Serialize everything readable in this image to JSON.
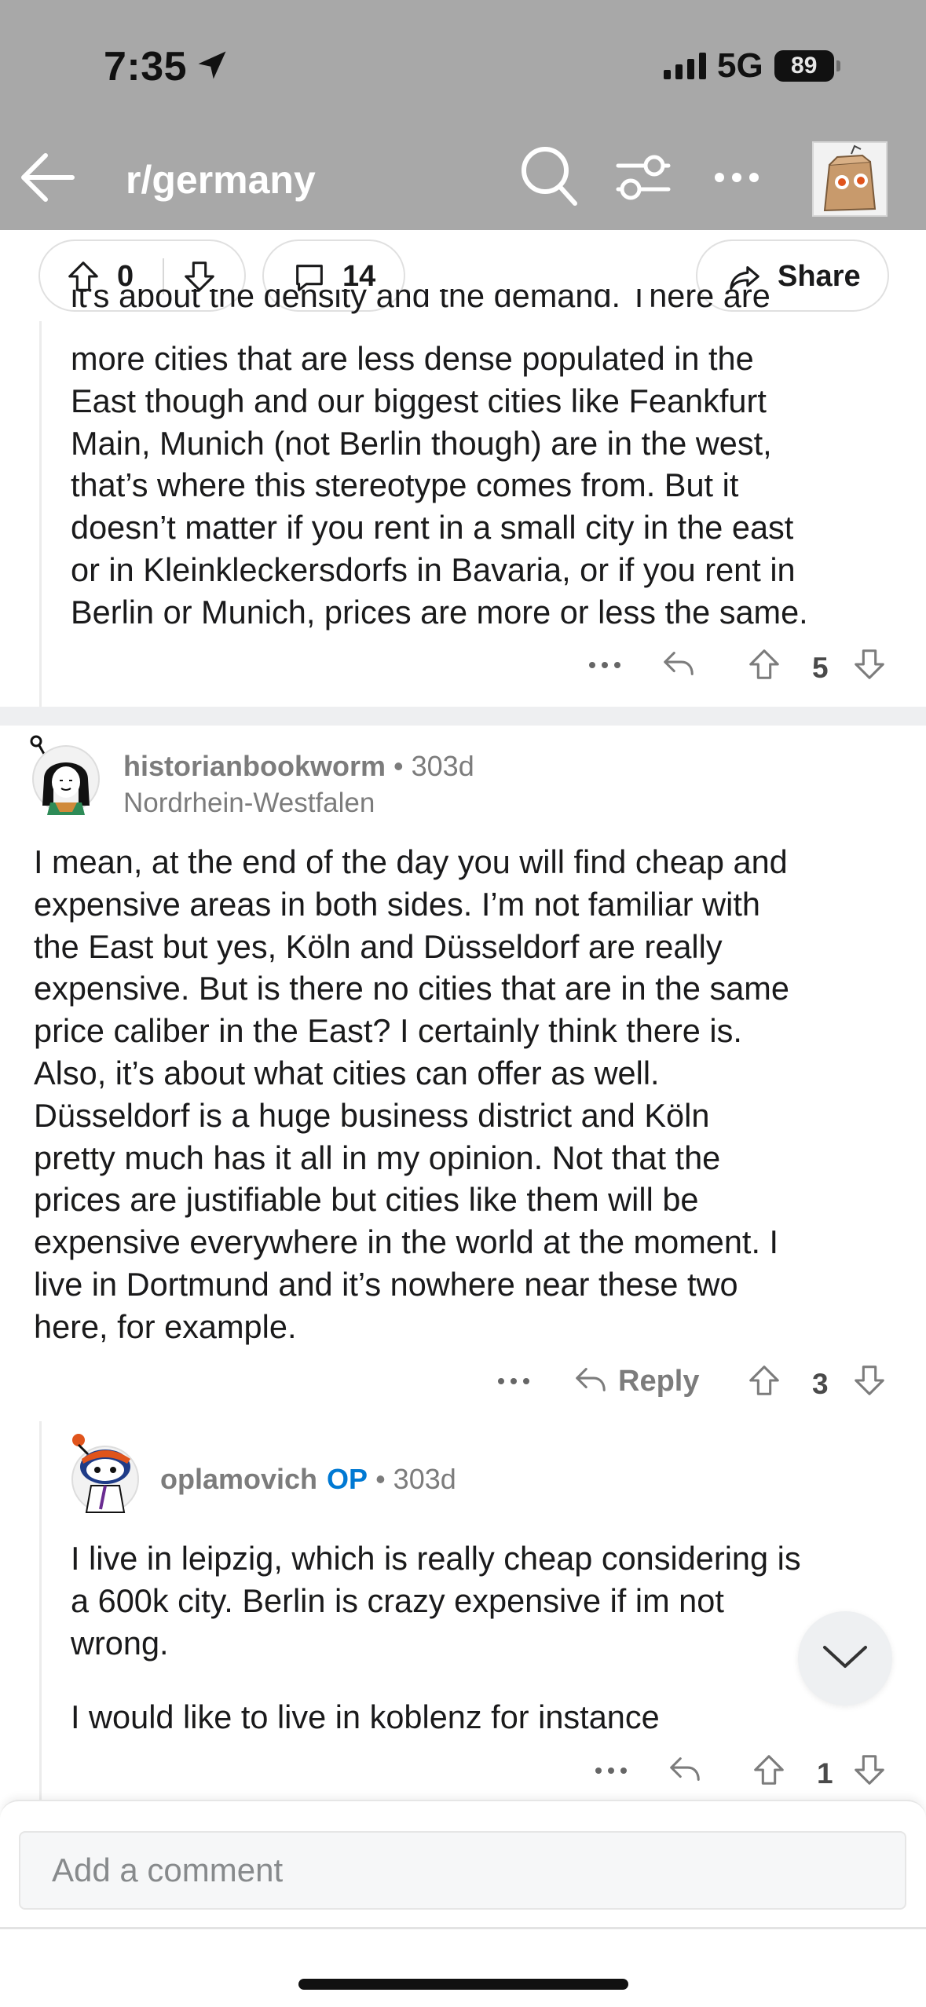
{
  "status_bar": {
    "time": "7:35",
    "network": "5G",
    "battery": "89"
  },
  "nav": {
    "title": "r/germany",
    "back_icon": "arrow-left-icon",
    "search_icon": "search-icon",
    "filter_icon": "sliders-icon",
    "more_icon": "more-horizontal-icon"
  },
  "post_actions": {
    "upvotes": "0",
    "comments": "14",
    "share_label": "Share"
  },
  "comments": [
    {
      "partial_first_line": "it's about the density and the demand. There are",
      "body_lines": [
        "more cities that are less dense populated in the",
        "East though and our biggest cities like Feankfurt",
        "Main, Munich (not Berlin though) are in the west,",
        "that’s where this stereotype comes from. But it",
        "doesn’t matter if you rent in a small city in the east",
        "or in Kleinkleckersdorfs in Bavaria, or if you rent in",
        "Berlin or Munich, prices are more or less the same."
      ],
      "score": "5"
    },
    {
      "username": "historianbookworm",
      "age": "303d",
      "flair": "Nordrhein-Westfalen",
      "body_lines": [
        "I mean, at the end of the day you will find cheap and",
        "expensive areas in both sides. I’m not familiar with",
        "the East but yes, Köln and Düsseldorf are really",
        "expensive. But is there no cities that are in the same",
        "price caliber in the East? I certainly think there is.",
        "Also, it’s about what cities can offer as well.",
        "Düsseldorf is a huge business district and Köln",
        "pretty much has it all in my opinion. Not that the",
        "prices are justifiable but cities like them will be",
        "expensive everywhere in the world at the moment. I",
        "live in Dortmund and it’s nowhere near these two",
        "here, for example."
      ],
      "reply_label": "Reply",
      "score": "3"
    },
    {
      "username": "oplamovich",
      "op_badge": "OP",
      "age": "303d",
      "body_lines": [
        "I live in leipzig, which is really cheap considering is",
        "a 600k city. Berlin is crazy expensive if im not",
        "wrong."
      ],
      "body_line_2": "I would like to live in koblenz for instance",
      "score": "1"
    }
  ],
  "comment_bar": {
    "placeholder": "Add a comment"
  }
}
